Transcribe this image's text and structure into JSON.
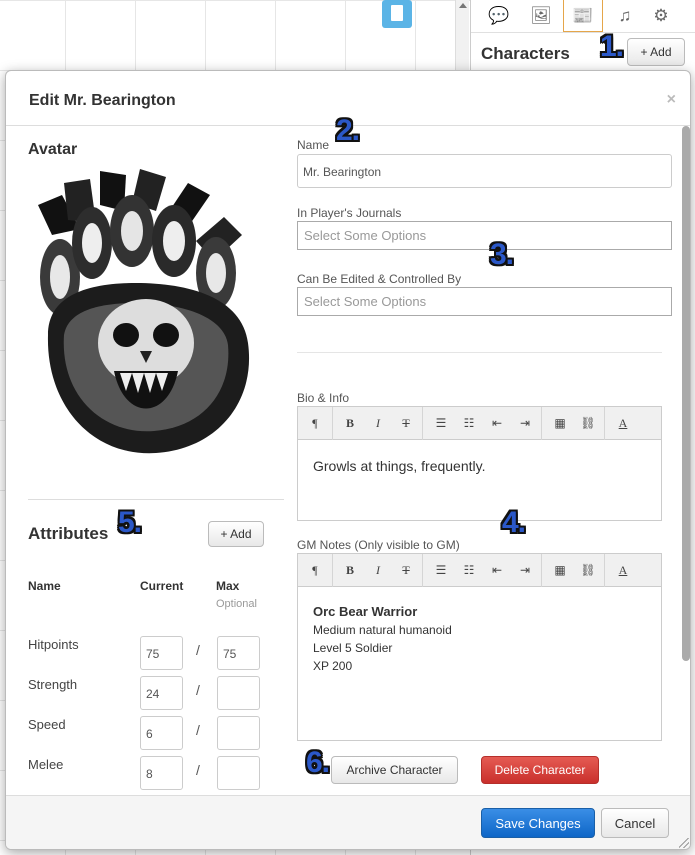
{
  "sidebar": {
    "tabs": [
      {
        "icon": "chat-icon",
        "glyph": "💬"
      },
      {
        "icon": "art-library-icon",
        "glyph": "🖼"
      },
      {
        "icon": "journal-icon",
        "glyph": "📰"
      },
      {
        "icon": "music-icon",
        "glyph": "♫"
      },
      {
        "icon": "settings-icon",
        "glyph": "⚙"
      }
    ],
    "active_tab": "journal-icon",
    "title": "Characters",
    "add_label": "+ Add"
  },
  "annotations": [
    "1.",
    "2.",
    "3.",
    "4.",
    "5.",
    "6."
  ],
  "dialog": {
    "title": "Edit Mr. Bearington",
    "close_glyph": "×",
    "avatar_heading": "Avatar",
    "name_label": "Name",
    "name_value": "Mr. Bearington",
    "journals_label": "In Player's Journals",
    "journals_placeholder": "Select Some Options",
    "controlled_label": "Can Be Edited & Controlled By",
    "controlled_placeholder": "Select Some Options",
    "bio_label": "Bio & Info",
    "bio_text": "Growls at things, frequently.",
    "gm_label": "GM Notes (Only visible to GM)",
    "gm_lines": [
      "Orc Bear Warrior",
      "Medium natural humanoid",
      "Level 5 Soldier",
      "XP 200"
    ],
    "toolbar": {
      "paragraph": "¶",
      "bold": "B",
      "italic": "I",
      "strike": "T",
      "bullets": "☰",
      "numbers": "☷",
      "outdent": "⇤",
      "indent": "⇥",
      "table": "▦",
      "link": "⛓",
      "color": "A"
    },
    "attributes": {
      "heading": "Attributes",
      "add_label": "+ Add",
      "col_name": "Name",
      "col_current": "Current",
      "col_max": "Max",
      "col_max_sub": "Optional",
      "rows": [
        {
          "name": "Hitpoints",
          "current": "75",
          "max": "75"
        },
        {
          "name": "Strength",
          "current": "24",
          "max": ""
        },
        {
          "name": "Speed",
          "current": "6",
          "max": ""
        },
        {
          "name": "Melee",
          "current": "8",
          "max": ""
        }
      ],
      "separator": "/"
    },
    "archive_label": "Archive Character",
    "delete_label": "Delete Character",
    "save_label": "Save Changes",
    "cancel_label": "Cancel"
  }
}
